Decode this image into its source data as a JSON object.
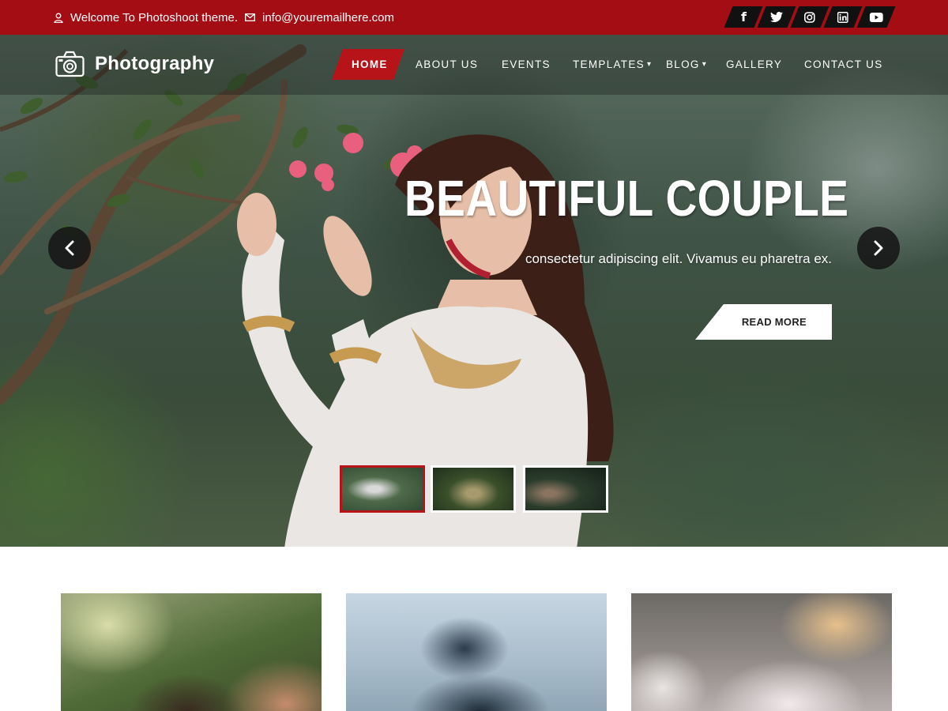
{
  "topbar": {
    "welcome": "Welcome To Photoshoot theme.",
    "email": "info@youremailhere.com",
    "socials": [
      {
        "icon": "facebook-icon",
        "glyph": "f"
      },
      {
        "icon": "twitter-icon",
        "glyph": ""
      },
      {
        "icon": "instagram-icon",
        "glyph": ""
      },
      {
        "icon": "linkedin-icon",
        "glyph": "in"
      },
      {
        "icon": "youtube-icon",
        "glyph": ""
      }
    ]
  },
  "header": {
    "logo_text": "Photography",
    "menu": [
      "HOME",
      "ABOUT US",
      "EVENTS",
      "TEMPLATES",
      "BLOG",
      "GALLERY",
      "CONTACT US"
    ],
    "chevron": "▾"
  },
  "slider": {
    "title": "BEAUTIFUL COUPLE",
    "subtitle": "consectetur adipiscing elit. Vivamus eu pharetra ex.",
    "button": "READ MORE",
    "active_slide": 1,
    "slide_count": 3
  },
  "colors": {
    "topbar": "#a30d13",
    "accent": "#b7141a",
    "social_bg": "#111111"
  }
}
